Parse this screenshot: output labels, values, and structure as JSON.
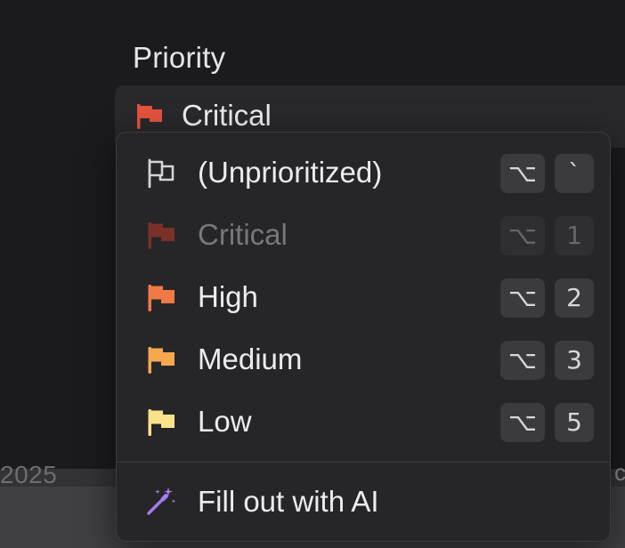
{
  "background": {
    "year_text": "2025",
    "edge_char": "c"
  },
  "field": {
    "label": "Priority",
    "value": "Critical",
    "value_icon": "flag-icon",
    "value_color": "#e5533d"
  },
  "menu": {
    "items": [
      {
        "label": "(Unprioritized)",
        "icon": "flag-outline-icon",
        "color": "#d4d4d6",
        "key_modifier": "⌥",
        "key": "`",
        "disabled": false
      },
      {
        "label": "Critical",
        "icon": "flag-icon",
        "color": "#7a3128",
        "key_modifier": "⌥",
        "key": "1",
        "disabled": true
      },
      {
        "label": "High",
        "icon": "flag-icon",
        "color": "#f07a45",
        "key_modifier": "⌥",
        "key": "2",
        "disabled": false
      },
      {
        "label": "Medium",
        "icon": "flag-icon",
        "color": "#f5a84f",
        "key_modifier": "⌥",
        "key": "3",
        "disabled": false
      },
      {
        "label": "Low",
        "icon": "flag-icon",
        "color": "#f9e28a",
        "key_modifier": "⌥",
        "key": "5",
        "disabled": false
      }
    ],
    "ai_action": {
      "label": "Fill out with AI",
      "icon": "magic-wand-icon",
      "color": "#a67cf0"
    }
  }
}
